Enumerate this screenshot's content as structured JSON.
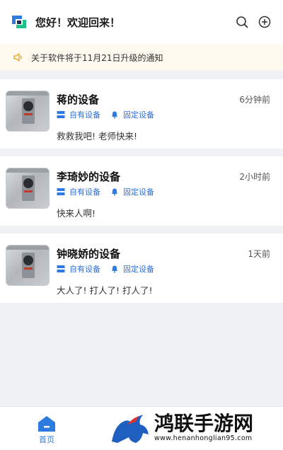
{
  "header": {
    "greeting": "您好！欢迎回来！",
    "icons": [
      "logo-icon",
      "search-icon",
      "add-circle-icon"
    ]
  },
  "notice": {
    "text": "关于软件将于11月21日升级的通知",
    "icon": "speaker-icon"
  },
  "devices": [
    {
      "title": "蒋的设备",
      "time": "6分钟前",
      "tag_owned": "自有设备",
      "tag_fixed": "固定设备",
      "message": "救救我吧! 老师快来!"
    },
    {
      "title": "李琦妙的设备",
      "time": "2小时前",
      "tag_owned": "自有设备",
      "tag_fixed": "固定设备",
      "message": "快来人啊!"
    },
    {
      "title": "钟晓娇的设备",
      "time": "1天前",
      "tag_owned": "自有设备",
      "tag_fixed": "固定设备",
      "message": "大人了! 打人了! 打人了!"
    }
  ],
  "tabbar": {
    "home_label": "首页"
  },
  "watermark": {
    "title": "鸿联手游网",
    "url": "www.henanhonglian95.com"
  },
  "colors": {
    "accent": "#2d7be0",
    "notice_bg": "#fdf9ee",
    "page_bg": "#eff1f5"
  }
}
